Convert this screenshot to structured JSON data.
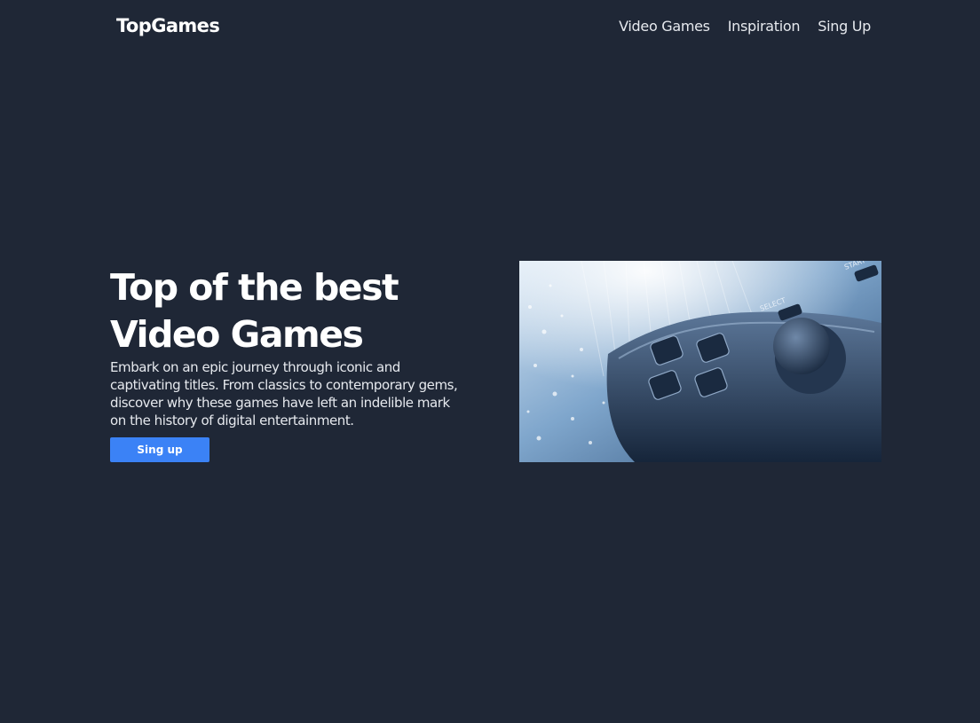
{
  "header": {
    "logo": "TopGames",
    "nav": [
      {
        "label": "Video Games"
      },
      {
        "label": "Inspiration"
      },
      {
        "label": "Sing Up"
      }
    ]
  },
  "hero": {
    "title_line1": "Top of the best",
    "title_line2": "Video Games",
    "description": "Embark on an epic journey through iconic and captivating titles. From classics to contemporary gems, discover why these games have left an indelible mark on the history of digital entertainment.",
    "cta_label": "Sing up",
    "image": {
      "subject": "gamepad-controller-photo",
      "button_labels": [
        "SELECT",
        "START"
      ]
    }
  },
  "colors": {
    "background": "#1f2736",
    "accent": "#3b82f6",
    "text": "#ffffff"
  }
}
